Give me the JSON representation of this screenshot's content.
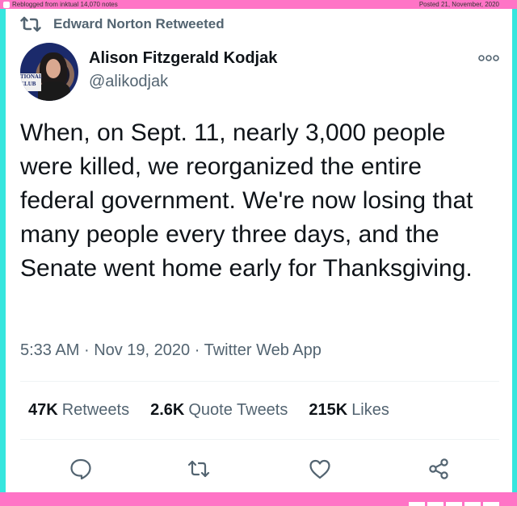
{
  "tumblr": {
    "reblog_note": "Reblogged from inktual  14,070 notes",
    "posted": "Posted 21, November, 2020"
  },
  "retweet": {
    "label": "Edward Norton Retweeted"
  },
  "author": {
    "name": "Alison Fitzgerald Kodjak",
    "handle": "@alikodjak",
    "avatar_tag": "TIONAL CLUB"
  },
  "tweet": {
    "text": "When, on Sept. 11, nearly 3,000 people were killed, we reorganized the entire federal government. We're now losing that many people every three days, and the Senate went home early for Thanksgiving.",
    "time": "5:33 AM",
    "date": "Nov 19, 2020",
    "source": "Twitter Web App",
    "meta_sep": "·"
  },
  "stats": [
    {
      "num": "47K",
      "label": "Retweets"
    },
    {
      "num": "2.6K",
      "label": "Quote Tweets"
    },
    {
      "num": "215K",
      "label": "Likes"
    }
  ],
  "actions": [
    "reply-icon",
    "retweet-icon",
    "like-icon",
    "share-icon"
  ],
  "colors": {
    "pink": "#ff74c6",
    "cyan": "#36e6de",
    "muted": "#536471",
    "text": "#0f1419"
  }
}
